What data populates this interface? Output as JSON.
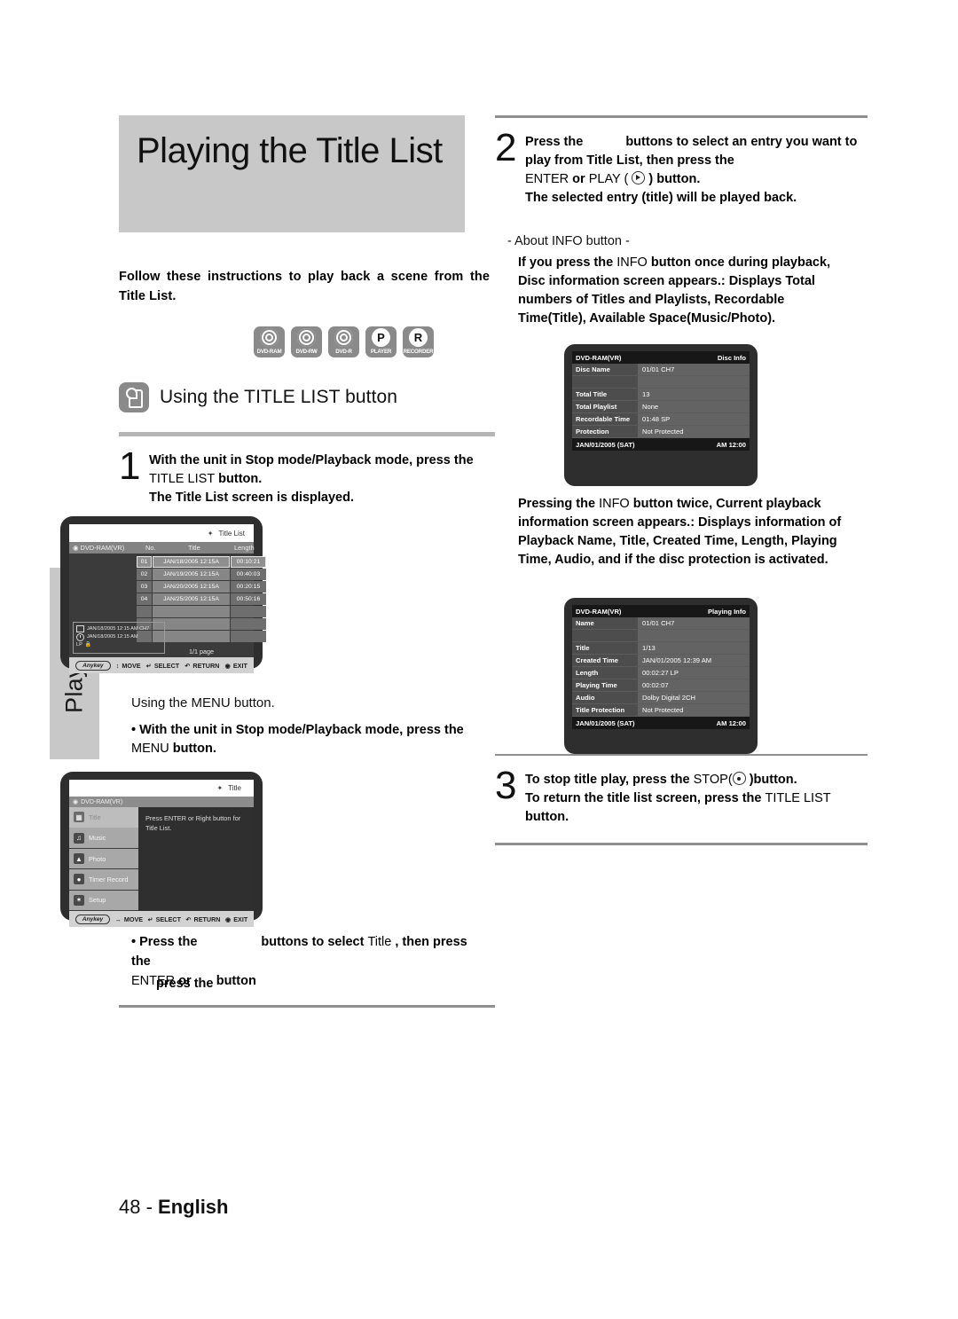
{
  "sidebar": {
    "tab_label": "Playback"
  },
  "header": {
    "title": "Playing the Title List"
  },
  "intro": "Follow these instructions to play back a scene from the Title List.",
  "disc_icons": [
    {
      "caption": "DVD-RAM",
      "glyph": "disc-icon"
    },
    {
      "caption": "DVD-RW",
      "glyph": "disc-icon"
    },
    {
      "caption": "DVD-R",
      "glyph": "disc-icon"
    },
    {
      "caption": "PLAYER",
      "glyph": "player-icon",
      "letter": "P"
    },
    {
      "caption": "RECORDER",
      "glyph": "recorder-icon",
      "letter": "R"
    }
  ],
  "section": {
    "heading": "Using the TITLE LIST button",
    "icon": "hand-press-icon"
  },
  "steps": {
    "one": {
      "num": "1",
      "line1_a": "With the unit in Stop mode/Playback mode, press the ",
      "line1_key": "TITLE LIST",
      "line1_b": " button.",
      "line2": "The Title List screen is displayed."
    },
    "two": {
      "num": "2",
      "line1_a": "Press the ",
      "line1_b": " buttons to select an entry you want to play from Title List, then press the ",
      "key_enter": "ENTER",
      "or": " or ",
      "key_play": "PLAY",
      "line1_c": " ) button.",
      "line2": "The selected entry (title) will be played back."
    },
    "three": {
      "num": "3",
      "line1_a": "To stop title play, press the ",
      "key_stop": "STOP",
      "line1_b": " )button.",
      "line2_a": "To return the title list screen, press the ",
      "key_titlelist": "TITLE LIST",
      "line2_b": " button."
    }
  },
  "menu_section": {
    "heading": "Using the MENU button.",
    "bullet1_a": "• With the unit in Stop mode/Playback mode, press the ",
    "bullet1_key": "MENU",
    "bullet1_b": " button.",
    "bullet2_a": "• Press the ",
    "bullet2_b": " buttons to select ",
    "bullet2_key": "Title",
    "bullet2_c": " , then press the ",
    "bullet2_enter": "ENTER",
    "bullet2_d": " or ",
    "bullet2_e": " button"
  },
  "about_info": {
    "heading": "- About INFO button -",
    "para1_a": "If you press the ",
    "para1_key": "INFO",
    "para1_b": " button once during playback, Disc information screen appears.: Displays Total numbers of Titles and Playlists, Recordable Time(Title), Available Space(Music/Photo).",
    "para2_a": "Pressing the ",
    "para2_key": "INFO",
    "para2_b": " button twice, Current playback information screen appears.: Displays information of Playback Name, Title, Created Time, Length, Playing Time, Audio, and if the disc protection is activated."
  },
  "title_list_screen": {
    "top_label": "Title List",
    "disc_label": "DVD-RAM(VR)",
    "col_no": "No.",
    "col_title": "Title",
    "col_length": "Length",
    "rows": [
      {
        "no": "01",
        "title": "JAN/18/2005 12:15A",
        "length": "00:10:21",
        "selected": true
      },
      {
        "no": "02",
        "title": "JAN/19/2005 12:15A",
        "length": "00:40:03",
        "selected": false
      },
      {
        "no": "03",
        "title": "JAN/20/2005 12:15A",
        "length": "00:20:15",
        "selected": false
      },
      {
        "no": "04",
        "title": "JAN/25/2005 12:15A",
        "length": "00:50:16",
        "selected": false
      }
    ],
    "empty_rows": 4,
    "page_indicator": "1/1 page",
    "info_box": {
      "line1": "JAN/18/2005 12:15 AM CH7",
      "line2": "JAN/18/2005 12:15 AM",
      "line3": "LP"
    },
    "footer": {
      "anykey": "Anykey",
      "move": "MOVE",
      "select": "SELECT",
      "return": "RETURN",
      "exit": "EXIT"
    }
  },
  "menu_screen": {
    "top_label": "Title",
    "disc_label": "DVD-RAM(VR)",
    "items": [
      {
        "label": "Title",
        "icon": "film-icon",
        "active": true
      },
      {
        "label": "Music",
        "icon": "music-note-icon",
        "active": false
      },
      {
        "label": "Photo",
        "icon": "photo-icon",
        "active": false
      },
      {
        "label": "Timer Record",
        "icon": "clock-icon",
        "active": false
      },
      {
        "label": "Setup",
        "icon": "gear-icon",
        "active": false
      }
    ],
    "pane_text": "Press ENTER or Right button for Title List.",
    "footer": {
      "anykey": "Anykey",
      "move": "MOVE",
      "select": "SELECT",
      "return": "RETURN",
      "exit": "EXIT"
    }
  },
  "disc_info_screen": {
    "head_left": "DVD-RAM(VR)",
    "head_right": "Disc Info",
    "rows": [
      {
        "key": "Disc Name",
        "value": "01/01 CH7"
      },
      {
        "key": "",
        "value": ""
      },
      {
        "key": "Total Title",
        "value": "13"
      },
      {
        "key": "Total Playlist",
        "value": "None"
      },
      {
        "key": "Recordable Time",
        "value": "01:48  SP"
      },
      {
        "key": "Protection",
        "value": "Not Protected"
      }
    ],
    "foot_left": "JAN/01/2005 (SAT)",
    "foot_right": "AM 12:00"
  },
  "playing_info_screen": {
    "head_left": "DVD-RAM(VR)",
    "head_right": "Playing Info",
    "rows": [
      {
        "key": "Name",
        "value": "01/01 CH7"
      },
      {
        "key": "",
        "value": ""
      },
      {
        "key": "Title",
        "value": "1/13"
      },
      {
        "key": "Created Time",
        "value": "JAN/01/2005 12:39 AM"
      },
      {
        "key": "Length",
        "value": "00:02:27 LP"
      },
      {
        "key": "Playing Time",
        "value": "00:02:07"
      },
      {
        "key": "Audio",
        "value": "Dolby Digital  2CH"
      },
      {
        "key": "Title Protection",
        "value": "Not Protected"
      }
    ],
    "foot_left": "JAN/01/2005 (SAT)",
    "foot_right": "AM 12:00"
  },
  "footer": {
    "page_number": "48 - ",
    "language": "English"
  }
}
